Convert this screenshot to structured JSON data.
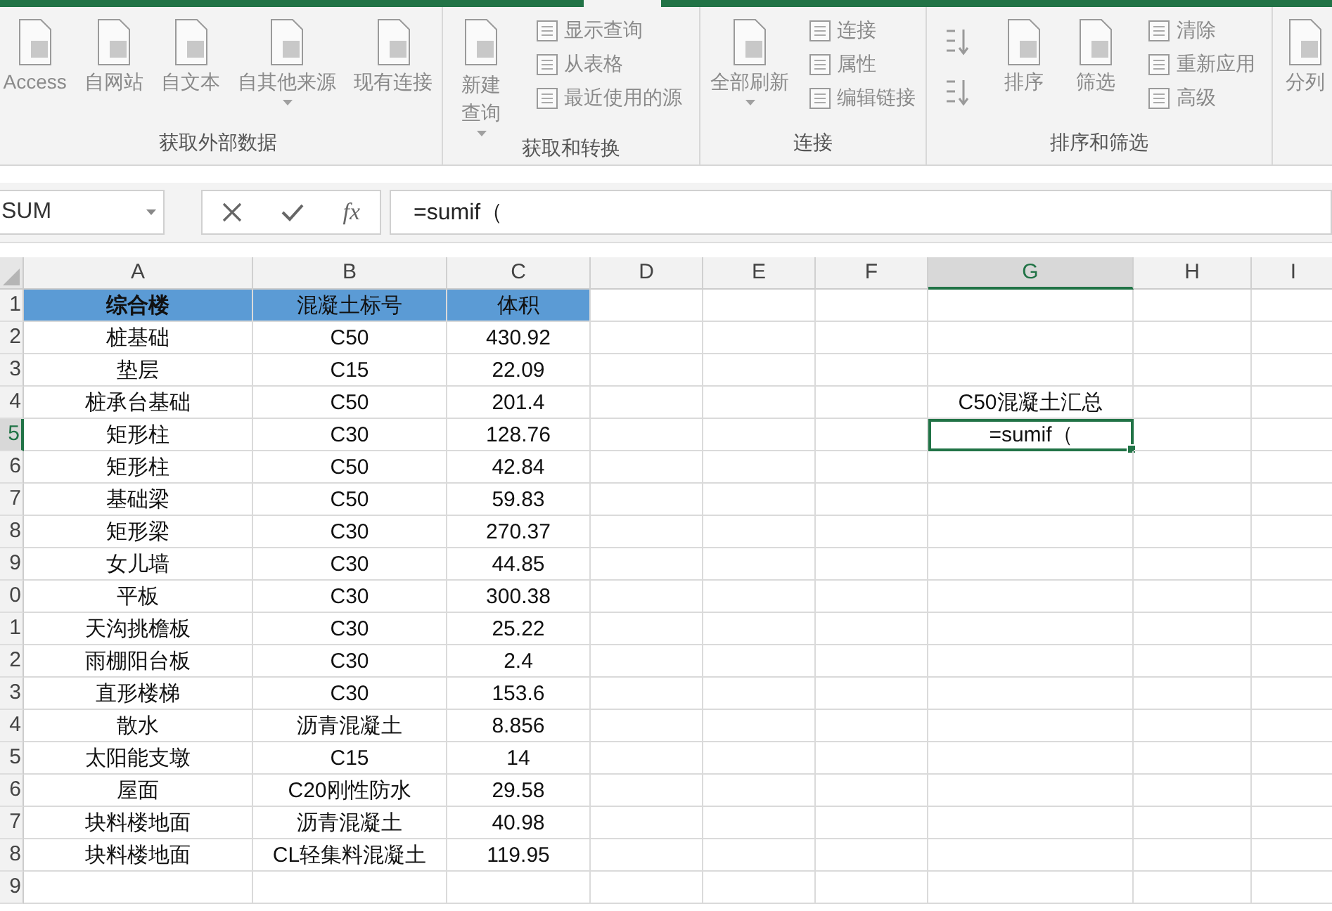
{
  "ribbon": {
    "groups": [
      {
        "label": "获取外部数据",
        "buttons": [
          {
            "kind": "large",
            "label": "Access",
            "dropdown": false
          },
          {
            "kind": "large",
            "label": "自网站",
            "dropdown": false
          },
          {
            "kind": "large",
            "label": "自文本",
            "dropdown": false
          },
          {
            "kind": "large",
            "label": "自其他来源",
            "dropdown": true
          },
          {
            "kind": "large",
            "label": "现有连接",
            "dropdown": false
          }
        ]
      },
      {
        "label": "获取和转换",
        "buttons": [
          {
            "kind": "large",
            "label": "新建查询",
            "dropdown": true
          },
          {
            "kind": "stack",
            "items": [
              "显示查询",
              "从表格",
              "最近使用的源"
            ]
          }
        ]
      },
      {
        "label": "连接",
        "buttons": [
          {
            "kind": "large",
            "label": "全部刷新",
            "dropdown": true
          },
          {
            "kind": "stack",
            "items": [
              "连接",
              "属性",
              "编辑链接"
            ]
          }
        ]
      },
      {
        "label": "排序和筛选",
        "buttons": [
          {
            "kind": "sorters"
          },
          {
            "kind": "large",
            "label": "排序",
            "dropdown": false
          },
          {
            "kind": "large",
            "label": "筛选",
            "dropdown": false
          },
          {
            "kind": "stack",
            "items": [
              "清除",
              "重新应用",
              "高级"
            ]
          }
        ]
      },
      {
        "buttons": [
          {
            "kind": "large",
            "label": "分列",
            "dropdown": false
          }
        ]
      }
    ]
  },
  "formula_bar": {
    "name_box": "SUM",
    "fx": "fx",
    "formula": "=sumif（"
  },
  "sheet": {
    "columns": [
      {
        "label": "A",
        "selected": false
      },
      {
        "label": "B",
        "selected": false
      },
      {
        "label": "C",
        "selected": false
      },
      {
        "label": "D",
        "selected": false
      },
      {
        "label": "E",
        "selected": false
      },
      {
        "label": "F",
        "selected": false
      },
      {
        "label": "G",
        "selected": true
      },
      {
        "label": "H",
        "selected": false
      },
      {
        "label": "I",
        "selected": false
      }
    ],
    "rows": [
      {
        "header": "1",
        "selected": false,
        "kind": "header",
        "cells": [
          "综合楼",
          "混凝土标号",
          "体积"
        ]
      },
      {
        "header": "2",
        "selected": false,
        "kind": "data",
        "cells": [
          "桩基础",
          "C50",
          "430.92"
        ]
      },
      {
        "header": "3",
        "selected": false,
        "kind": "data",
        "cells": [
          "垫层",
          "C15",
          "22.09"
        ]
      },
      {
        "header": "4",
        "selected": false,
        "kind": "data",
        "cells": [
          "桩承台基础",
          "C50",
          "201.4"
        ],
        "column_g": {
          "text": "C50混凝土汇总",
          "active": false
        }
      },
      {
        "header": "5",
        "selected": true,
        "kind": "data",
        "cells": [
          "矩形柱",
          "C30",
          "128.76"
        ],
        "column_g": {
          "text": "=sumif（",
          "active": true
        }
      },
      {
        "header": "6",
        "selected": false,
        "kind": "data",
        "cells": [
          "矩形柱",
          "C50",
          "42.84"
        ]
      },
      {
        "header": "7",
        "selected": false,
        "kind": "data",
        "cells": [
          "基础梁",
          "C50",
          "59.83"
        ]
      },
      {
        "header": "8",
        "selected": false,
        "kind": "data",
        "cells": [
          "矩形梁",
          "C30",
          "270.37"
        ]
      },
      {
        "header": "9",
        "selected": false,
        "kind": "data",
        "cells": [
          "女儿墙",
          "C30",
          "44.85"
        ]
      },
      {
        "header": "0",
        "selected": false,
        "kind": "data",
        "cells": [
          "平板",
          "C30",
          "300.38"
        ]
      },
      {
        "header": "1",
        "selected": false,
        "kind": "data",
        "cells": [
          "天沟挑檐板",
          "C30",
          "25.22"
        ]
      },
      {
        "header": "2",
        "selected": false,
        "kind": "data",
        "cells": [
          "雨棚阳台板",
          "C30",
          "2.4"
        ]
      },
      {
        "header": "3",
        "selected": false,
        "kind": "data",
        "cells": [
          "直形楼梯",
          "C30",
          "153.6"
        ]
      },
      {
        "header": "4",
        "selected": false,
        "kind": "data",
        "cells": [
          "散水",
          "沥青混凝土",
          "8.856"
        ]
      },
      {
        "header": "5",
        "selected": false,
        "kind": "data",
        "cells": [
          "太阳能支墩",
          "C15",
          "14"
        ]
      },
      {
        "header": "6",
        "selected": false,
        "kind": "data",
        "cells": [
          "屋面",
          "C20刚性防水",
          "29.58"
        ]
      },
      {
        "header": "7",
        "selected": false,
        "kind": "data",
        "cells": [
          "块料楼地面",
          "沥青混凝土",
          "40.98"
        ]
      },
      {
        "header": "8",
        "selected": false,
        "kind": "data",
        "cells": [
          "块料楼地面",
          "CL轻集料混凝土",
          "119.95"
        ]
      },
      {
        "header": "9",
        "selected": false
      }
    ]
  }
}
